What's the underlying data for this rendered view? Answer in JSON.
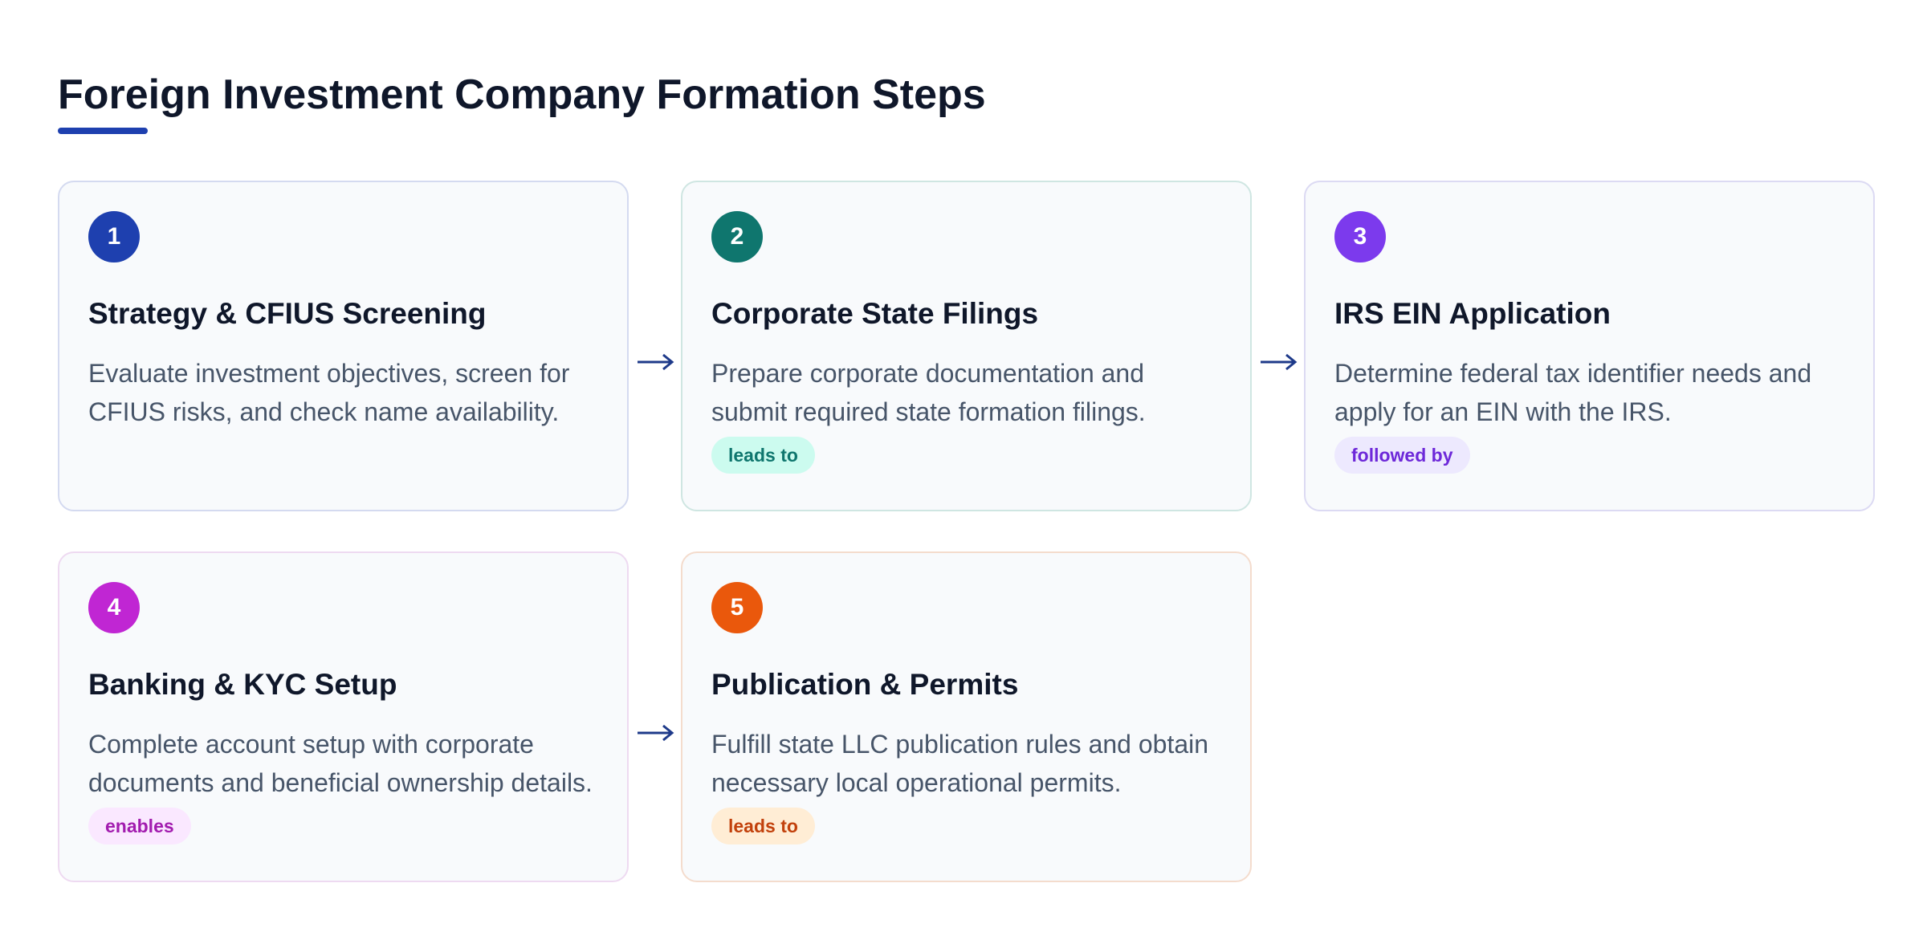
{
  "title": "Foreign Investment Company Formation Steps",
  "colors": {
    "accent": "#1e40af",
    "title_text": "#0f172a",
    "body_text": "#475569",
    "card_background": "#f8fafc",
    "arrow": "#1e3a8a"
  },
  "steps": [
    {
      "number": "1",
      "title": "Strategy & CFIUS Screening",
      "description": "Evaluate investment objectives, screen for CFIUS risks, and check name availability.",
      "color": "#1e40af"
    },
    {
      "number": "2",
      "title": "Corporate State Filings",
      "description": "Prepare corporate documentation and submit required state formation filings.",
      "color": "#0f766e",
      "badge": {
        "label": "leads to",
        "bg": "#ccfbef",
        "fg": "#0f766e"
      }
    },
    {
      "number": "3",
      "title": "IRS EIN Application",
      "description": "Determine federal tax identifier needs and apply for an EIN with the IRS.",
      "color": "#7c3aed",
      "badge": {
        "label": "followed by",
        "bg": "#ede9fe",
        "fg": "#6d28d9"
      }
    },
    {
      "number": "4",
      "title": "Banking & KYC Setup",
      "description": "Complete account setup with corporate documents and beneficial ownership details.",
      "color": "#c026d3",
      "badge": {
        "label": "enables",
        "bg": "#fae8ff",
        "fg": "#a21caf"
      }
    },
    {
      "number": "5",
      "title": "Publication & Permits",
      "description": "Fulfill state LLC publication rules and obtain necessary local operational permits.",
      "color": "#ea580c",
      "badge": {
        "label": "leads to",
        "bg": "#ffedd5",
        "fg": "#c2410c"
      }
    }
  ],
  "arrows": [
    {
      "from": "1",
      "to": "2",
      "icon": "right-arrow-icon"
    },
    {
      "from": "2",
      "to": "3",
      "icon": "right-arrow-icon"
    },
    {
      "from": "4",
      "to": "5",
      "icon": "right-arrow-icon"
    }
  ]
}
